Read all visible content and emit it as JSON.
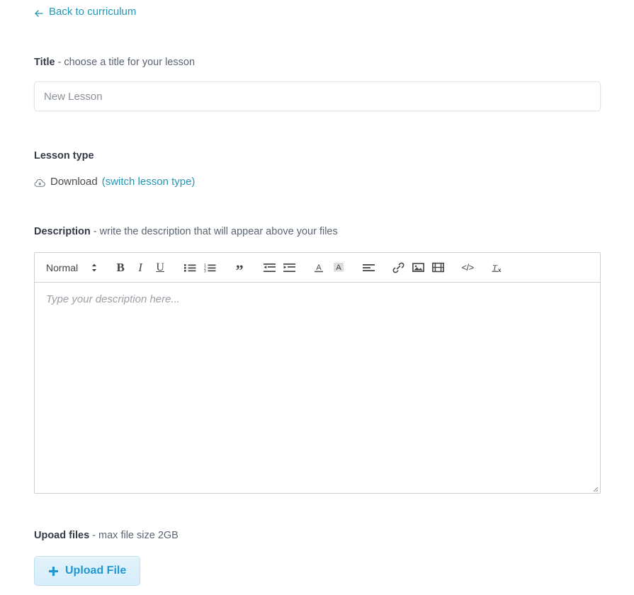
{
  "back": {
    "label": "Back to curriculum",
    "icon": "arrow-left-icon",
    "color": "#2196b5"
  },
  "title_field": {
    "label_strong": "Title",
    "label_rest": " - choose a title for your lesson",
    "value": "",
    "placeholder": "New Lesson"
  },
  "lesson_type": {
    "label": "Lesson type",
    "icon": "cloud-download-icon",
    "value": "Download",
    "switch_link": "(switch lesson type)"
  },
  "description": {
    "label_strong": "Description",
    "label_rest": " - write the description that will appear above your files",
    "placeholder": "Type your description here...",
    "content": "",
    "toolbar": {
      "format_picker": {
        "value": "Normal",
        "icon": "stepper-updown-icon"
      },
      "buttons": [
        {
          "name": "bold-button",
          "label": "B"
        },
        {
          "name": "italic-button",
          "label": "I"
        },
        {
          "name": "underline-button",
          "label": "U"
        },
        {
          "name": "bullet-list-button",
          "label": ""
        },
        {
          "name": "numbered-list-button",
          "label": ""
        },
        {
          "name": "blockquote-button",
          "label": "”"
        },
        {
          "name": "outdent-button",
          "label": ""
        },
        {
          "name": "indent-button",
          "label": ""
        },
        {
          "name": "text-color-button",
          "label": "A"
        },
        {
          "name": "background-color-button",
          "label": "A"
        },
        {
          "name": "align-button",
          "label": ""
        },
        {
          "name": "link-button",
          "label": ""
        },
        {
          "name": "image-button",
          "label": ""
        },
        {
          "name": "video-button",
          "label": ""
        },
        {
          "name": "code-block-button",
          "label": "</>"
        },
        {
          "name": "clear-formatting-button",
          "label": "Tx"
        }
      ]
    }
  },
  "upload": {
    "label_strong": "Upoad files",
    "label_rest": " - max file size 2GB",
    "button_label": "Upload File",
    "button_icon": "plus-icon",
    "accent_color": "#2196cf"
  }
}
